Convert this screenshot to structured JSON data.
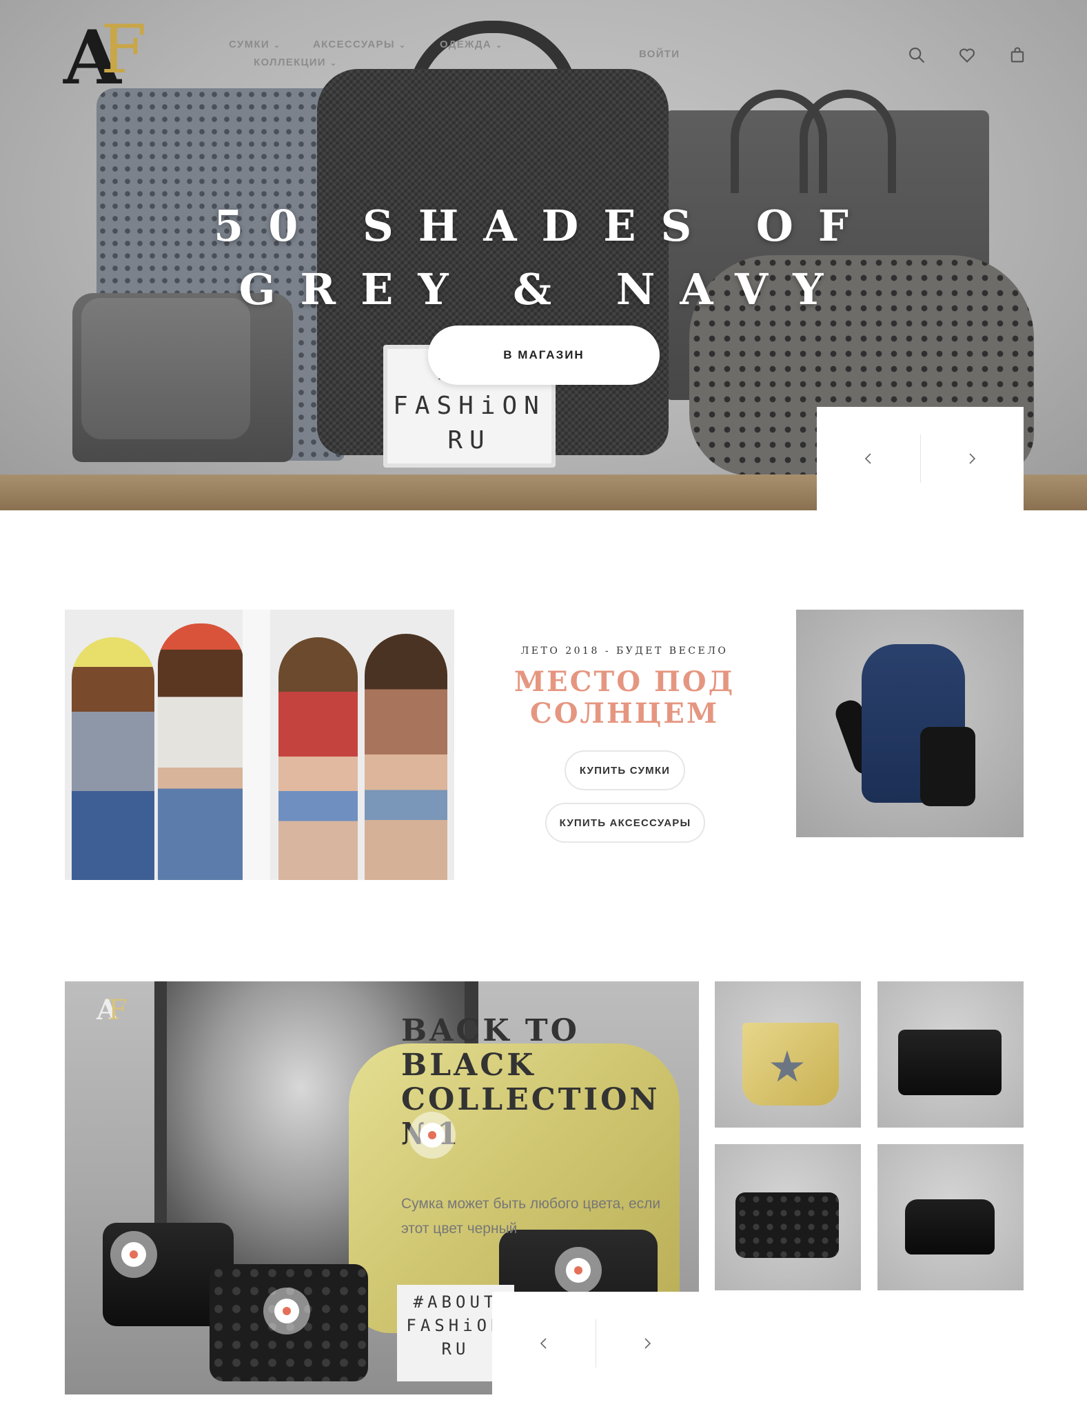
{
  "header": {
    "logo_letters": [
      "A",
      "F"
    ],
    "nav": [
      {
        "label": "СУМКИ",
        "has_dropdown": true
      },
      {
        "label": "АКСЕССУАРЫ",
        "has_dropdown": true
      },
      {
        "label": "ОДЕЖДА",
        "has_dropdown": true
      },
      {
        "label": "КОЛЛЕКЦИИ",
        "has_dropdown": true
      }
    ],
    "login_label": "ВОЙТИ",
    "icons": [
      "search-icon",
      "heart-icon",
      "cart-icon"
    ]
  },
  "hero": {
    "title_line1": "50 SHADES OF",
    "title_line2": "GREY & NAVY",
    "cta_label": "В МАГАЗИН",
    "lightbox_lines": [
      "# A",
      "FASHiON",
      "RU"
    ]
  },
  "summer": {
    "kicker": "ЛЕТО 2018 - БУДЕТ ВЕСЕЛО",
    "title": "МЕСТО ПОД СОЛНЦЕМ",
    "buttons": {
      "bags": "КУПИТЬ СУМКИ",
      "accessories": "КУПИТЬ АКСЕССУАРЫ"
    }
  },
  "collection": {
    "logo_letters": [
      "A",
      "F"
    ],
    "title": "BACK TO BLACK COLLECTION №1",
    "subtitle": "Сумка может быть любого цвета, если этот цвет черный",
    "lightbox_lines": [
      "#ABOUT",
      "FASHiON",
      "RU"
    ],
    "hotspot_count": 4,
    "accent_color": "#e4705a"
  },
  "colors": {
    "accent": "#e59680",
    "gold": "#c9a646",
    "nav_text": "#8c8c8c"
  }
}
